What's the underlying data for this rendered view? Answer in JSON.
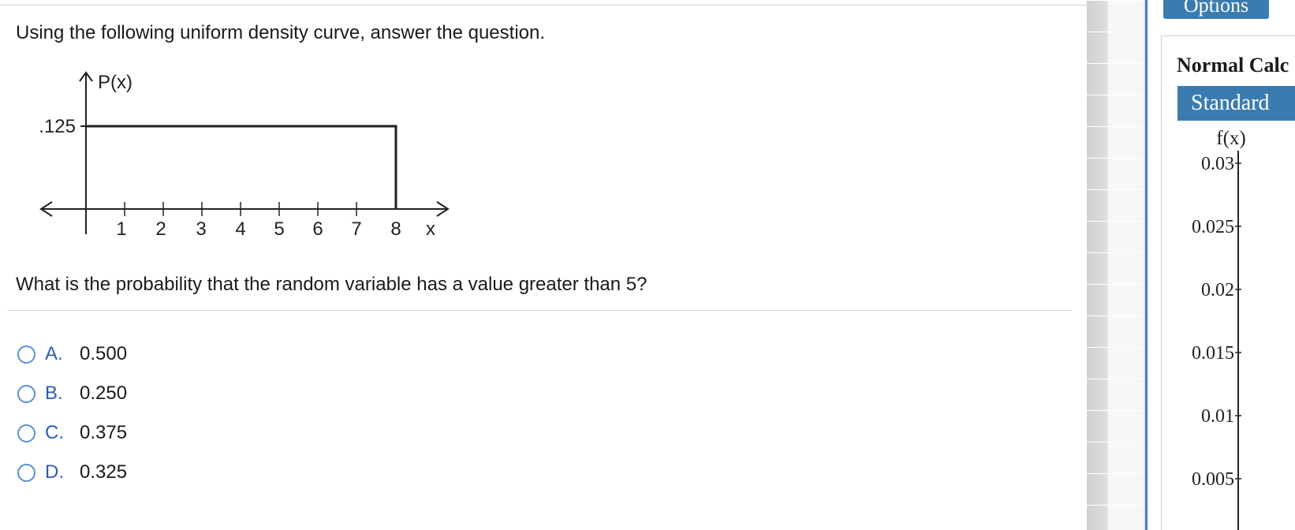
{
  "question": {
    "prompt": "Using the following uniform density curve, answer the question.",
    "text": "What is the probability that the random variable has a value greater than 5?"
  },
  "graph": {
    "y_label": "P(x)",
    "y_tick": ".125",
    "x_var": "x",
    "x_ticks": [
      "1",
      "2",
      "3",
      "4",
      "5",
      "6",
      "7",
      "8"
    ]
  },
  "choices": [
    {
      "letter": "A.",
      "value": "0.500"
    },
    {
      "letter": "B.",
      "value": "0.250"
    },
    {
      "letter": "C.",
      "value": "0.375"
    },
    {
      "letter": "D.",
      "value": "0.325"
    }
  ],
  "side": {
    "options_label": "Options",
    "calc_title": "Normal Calc",
    "tab_label": "Standard",
    "fx_label": "f(x)",
    "y_ticks": [
      "0.03",
      "0.025",
      "0.02",
      "0.015",
      "0.01",
      "0.005"
    ]
  },
  "colors": {
    "accent_blue": "#3b7cb0",
    "choice_letter": "#2c5cb5",
    "radio_border": "#5b8ed6",
    "divider": "#3f7fd9"
  },
  "chart_data": {
    "type": "line",
    "x": [
      0,
      8
    ],
    "y": [
      0.125,
      0.125
    ],
    "title": "",
    "xlabel": "x",
    "ylabel": "P(x)",
    "xlim": [
      0,
      8
    ],
    "x_ticks": [
      1,
      2,
      3,
      4,
      5,
      6,
      7,
      8
    ],
    "y_ticks": [
      0.125
    ],
    "grid": false
  }
}
